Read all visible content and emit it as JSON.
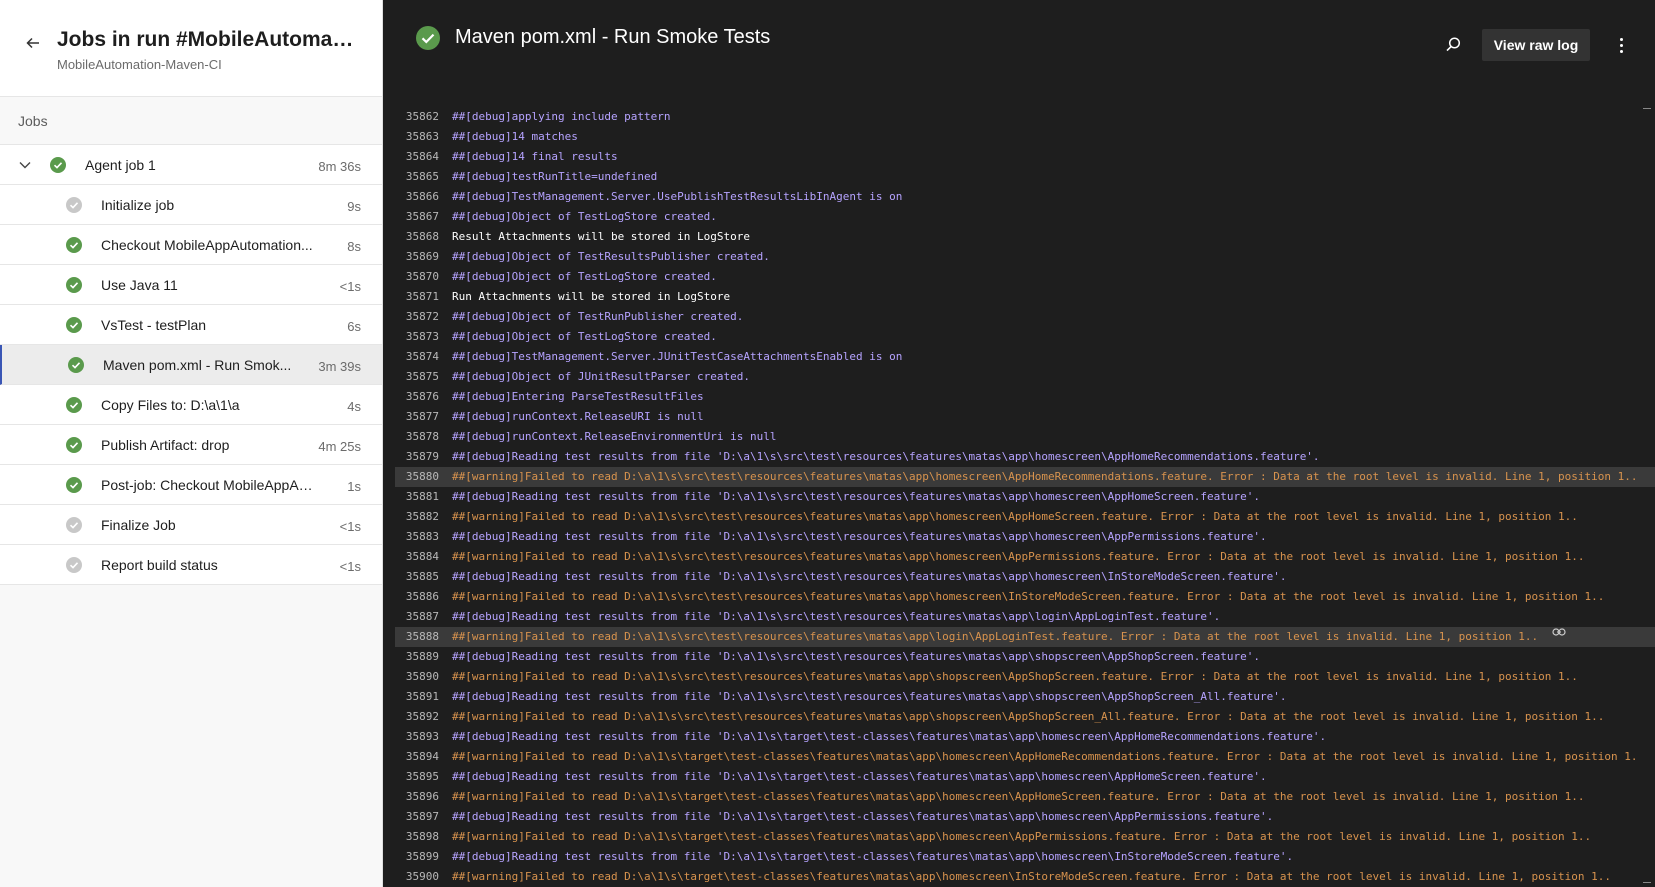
{
  "left": {
    "title": "Jobs in run #MobileAutomatio...",
    "subtitle": "MobileAutomation-Maven-CI",
    "jobs_label": "Jobs",
    "group": {
      "label": "Agent job 1",
      "duration": "8m 36s"
    },
    "steps": [
      {
        "label": "Initialize job",
        "duration": "9s",
        "status": "skipped"
      },
      {
        "label": "Checkout MobileAppAutomation...",
        "duration": "8s",
        "status": "success"
      },
      {
        "label": "Use Java 11",
        "duration": "<1s",
        "status": "success"
      },
      {
        "label": "VsTest - testPlan",
        "duration": "6s",
        "status": "success"
      },
      {
        "label": "Maven pom.xml - Run Smok...",
        "duration": "3m 39s",
        "status": "success"
      },
      {
        "label": "Copy Files to: D:\\a\\1\\a",
        "duration": "4s",
        "status": "success"
      },
      {
        "label": "Publish Artifact: drop",
        "duration": "4m 25s",
        "status": "success"
      },
      {
        "label": "Post-job: Checkout MobileAppAut...",
        "duration": "1s",
        "status": "success"
      },
      {
        "label": "Finalize Job",
        "duration": "<1s",
        "status": "skipped"
      },
      {
        "label": "Report build status",
        "duration": "<1s",
        "status": "skipped"
      }
    ]
  },
  "right": {
    "title": "Maven pom.xml - Run Smoke Tests",
    "raw_log_label": "View raw log"
  },
  "log": [
    {
      "n": "35862",
      "t": "##[debug]applying include pattern",
      "k": "debug"
    },
    {
      "n": "35863",
      "t": "##[debug]14 matches",
      "k": "debug"
    },
    {
      "n": "35864",
      "t": "##[debug]14 final results",
      "k": "debug"
    },
    {
      "n": "35865",
      "t": "##[debug]testRunTitle=undefined",
      "k": "debug"
    },
    {
      "n": "35866",
      "t": "##[debug]TestManagement.Server.UsePublishTestResultsLibInAgent is on",
      "k": "debug"
    },
    {
      "n": "35867",
      "t": "##[debug]Object of TestLogStore created.",
      "k": "debug"
    },
    {
      "n": "35868",
      "t": "Result Attachments will be stored in LogStore",
      "k": "plain"
    },
    {
      "n": "35869",
      "t": "##[debug]Object of TestResultsPublisher created.",
      "k": "debug"
    },
    {
      "n": "35870",
      "t": "##[debug]Object of TestLogStore created.",
      "k": "debug"
    },
    {
      "n": "35871",
      "t": "Run Attachments will be stored in LogStore",
      "k": "plain"
    },
    {
      "n": "35872",
      "t": "##[debug]Object of TestRunPublisher created.",
      "k": "debug"
    },
    {
      "n": "35873",
      "t": "##[debug]Object of TestLogStore created.",
      "k": "debug"
    },
    {
      "n": "35874",
      "t": "##[debug]TestManagement.Server.JUnitTestCaseAttachmentsEnabled is on",
      "k": "debug"
    },
    {
      "n": "35875",
      "t": "##[debug]Object of JUnitResultParser created.",
      "k": "debug"
    },
    {
      "n": "35876",
      "t": "##[debug]Entering ParseTestResultFiles",
      "k": "debug"
    },
    {
      "n": "35877",
      "t": "##[debug]runContext.ReleaseURI is null",
      "k": "debug"
    },
    {
      "n": "35878",
      "t": "##[debug]runContext.ReleaseEnvironmentUri is null",
      "k": "debug"
    },
    {
      "n": "35879",
      "t": "##[debug]Reading test results from file 'D:\\a\\1\\s\\src\\test\\resources\\features\\matas\\app\\homescreen\\AppHomeRecommendations.feature'.",
      "k": "debug"
    },
    {
      "n": "35880",
      "t": "##[warning]Failed to read D:\\a\\1\\s\\src\\test\\resources\\features\\matas\\app\\homescreen\\AppHomeRecommendations.feature. Error : Data at the root level is invalid. Line 1, position 1..",
      "k": "warning",
      "hl": true
    },
    {
      "n": "35881",
      "t": "##[debug]Reading test results from file 'D:\\a\\1\\s\\src\\test\\resources\\features\\matas\\app\\homescreen\\AppHomeScreen.feature'.",
      "k": "debug"
    },
    {
      "n": "35882",
      "t": "##[warning]Failed to read D:\\a\\1\\s\\src\\test\\resources\\features\\matas\\app\\homescreen\\AppHomeScreen.feature. Error : Data at the root level is invalid. Line 1, position 1..",
      "k": "warning"
    },
    {
      "n": "35883",
      "t": "##[debug]Reading test results from file 'D:\\a\\1\\s\\src\\test\\resources\\features\\matas\\app\\homescreen\\AppPermissions.feature'.",
      "k": "debug"
    },
    {
      "n": "35884",
      "t": "##[warning]Failed to read D:\\a\\1\\s\\src\\test\\resources\\features\\matas\\app\\homescreen\\AppPermissions.feature. Error : Data at the root level is invalid. Line 1, position 1..",
      "k": "warning"
    },
    {
      "n": "35885",
      "t": "##[debug]Reading test results from file 'D:\\a\\1\\s\\src\\test\\resources\\features\\matas\\app\\homescreen\\InStoreModeScreen.feature'.",
      "k": "debug"
    },
    {
      "n": "35886",
      "t": "##[warning]Failed to read D:\\a\\1\\s\\src\\test\\resources\\features\\matas\\app\\homescreen\\InStoreModeScreen.feature. Error : Data at the root level is invalid. Line 1, position 1..",
      "k": "warning"
    },
    {
      "n": "35887",
      "t": "##[debug]Reading test results from file 'D:\\a\\1\\s\\src\\test\\resources\\features\\matas\\app\\login\\AppLoginTest.feature'.",
      "k": "debug"
    },
    {
      "n": "35888",
      "t": "##[warning]Failed to read D:\\a\\1\\s\\src\\test\\resources\\features\\matas\\app\\login\\AppLoginTest.feature. Error : Data at the root level is invalid. Line 1, position 1..",
      "k": "warning",
      "hl": true,
      "link": true
    },
    {
      "n": "35889",
      "t": "##[debug]Reading test results from file 'D:\\a\\1\\s\\src\\test\\resources\\features\\matas\\app\\shopscreen\\AppShopScreen.feature'.",
      "k": "debug"
    },
    {
      "n": "35890",
      "t": "##[warning]Failed to read D:\\a\\1\\s\\src\\test\\resources\\features\\matas\\app\\shopscreen\\AppShopScreen.feature. Error : Data at the root level is invalid. Line 1, position 1..",
      "k": "warning"
    },
    {
      "n": "35891",
      "t": "##[debug]Reading test results from file 'D:\\a\\1\\s\\src\\test\\resources\\features\\matas\\app\\shopscreen\\AppShopScreen_All.feature'.",
      "k": "debug"
    },
    {
      "n": "35892",
      "t": "##[warning]Failed to read D:\\a\\1\\s\\src\\test\\resources\\features\\matas\\app\\shopscreen\\AppShopScreen_All.feature. Error : Data at the root level is invalid. Line 1, position 1..",
      "k": "warning"
    },
    {
      "n": "35893",
      "t": "##[debug]Reading test results from file 'D:\\a\\1\\s\\target\\test-classes\\features\\matas\\app\\homescreen\\AppHomeRecommendations.feature'.",
      "k": "debug"
    },
    {
      "n": "35894",
      "t": "##[warning]Failed to read D:\\a\\1\\s\\target\\test-classes\\features\\matas\\app\\homescreen\\AppHomeRecommendations.feature. Error : Data at the root level is invalid. Line 1, position 1.",
      "k": "warning"
    },
    {
      "n": "35895",
      "t": "##[debug]Reading test results from file 'D:\\a\\1\\s\\target\\test-classes\\features\\matas\\app\\homescreen\\AppHomeScreen.feature'.",
      "k": "debug"
    },
    {
      "n": "35896",
      "t": "##[warning]Failed to read D:\\a\\1\\s\\target\\test-classes\\features\\matas\\app\\homescreen\\AppHomeScreen.feature. Error : Data at the root level is invalid. Line 1, position 1..",
      "k": "warning"
    },
    {
      "n": "35897",
      "t": "##[debug]Reading test results from file 'D:\\a\\1\\s\\target\\test-classes\\features\\matas\\app\\homescreen\\AppPermissions.feature'.",
      "k": "debug"
    },
    {
      "n": "35898",
      "t": "##[warning]Failed to read D:\\a\\1\\s\\target\\test-classes\\features\\matas\\app\\homescreen\\AppPermissions.feature. Error : Data at the root level is invalid. Line 1, position 1..",
      "k": "warning"
    },
    {
      "n": "35899",
      "t": "##[debug]Reading test results from file 'D:\\a\\1\\s\\target\\test-classes\\features\\matas\\app\\homescreen\\InStoreModeScreen.feature'.",
      "k": "debug"
    },
    {
      "n": "35900",
      "t": "##[warning]Failed to read D:\\a\\1\\s\\target\\test-classes\\features\\matas\\app\\homescreen\\InStoreModeScreen.feature. Error : Data at the root level is invalid. Line 1, position 1..",
      "k": "warning"
    }
  ],
  "colors": {
    "success": "#5a9a4c",
    "skipped": "#c8c8c8",
    "debug": "#b6a3ff",
    "warning": "#d8934e",
    "accent": "#3a56b5"
  }
}
